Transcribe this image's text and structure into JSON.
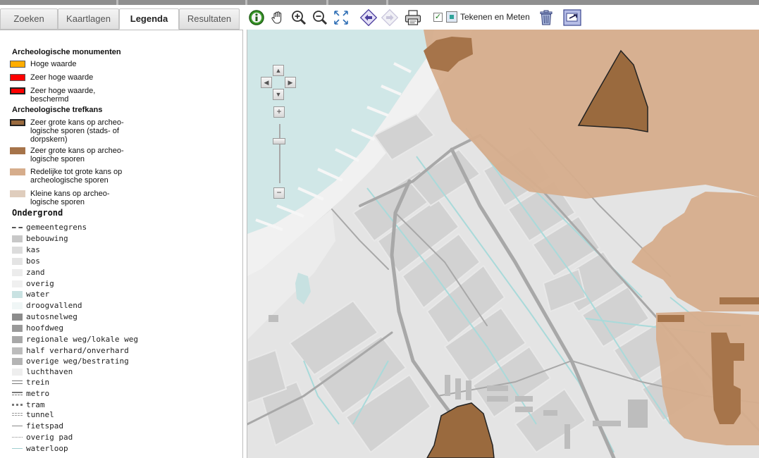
{
  "tabs": [
    {
      "label": "Zoeken"
    },
    {
      "label": "Kaartlagen"
    },
    {
      "label": "Legenda"
    },
    {
      "label": "Resultaten"
    }
  ],
  "legend": {
    "monumenten_title": "Archeologische monumenten",
    "monumenten": [
      {
        "label": "Hoge waarde",
        "color": "#ffad00"
      },
      {
        "label": "Zeer hoge waarde",
        "color": "#ff0000"
      },
      {
        "label": "Zeer hoge waarde, beschermd",
        "color": "#ff0000"
      }
    ],
    "trefkans_title": "Archeologische trefkans",
    "trefkans": [
      {
        "label": "Zeer grote kans op archeo-logische sporen (stads- of dorpskern)",
        "color": "#9a6a3e"
      },
      {
        "label": "Zeer grote kans op archeo-logische sporen",
        "color": "#a6744a"
      },
      {
        "label": "Redelijke tot grote kans op archeologische sporen",
        "color": "#d6ad8c"
      },
      {
        "label": "Kleine kans op archeo-logische sporen",
        "color": "#dfcdbd"
      }
    ],
    "ondergrond_title": "Ondergrond",
    "ondergrond": [
      {
        "label": "gemeentegrens",
        "icon": "dashed-line-icon"
      },
      {
        "label": "bebouwing",
        "color": "#c8c8c8"
      },
      {
        "label": "kas",
        "color": "#dcdcdc"
      },
      {
        "label": "bos",
        "color": "#e4e4e4"
      },
      {
        "label": "zand",
        "color": "#ececec"
      },
      {
        "label": "overig",
        "color": "#f0f0f0"
      },
      {
        "label": "water",
        "color": "#c9e2e2"
      },
      {
        "label": "droogvallend",
        "color": "#f0f6f6"
      },
      {
        "label": "autosnelweg",
        "color": "#8c8c8c"
      },
      {
        "label": "hoofdweg",
        "color": "#9a9a9a"
      },
      {
        "label": "regionale weg/lokale weg",
        "color": "#a8a8a8"
      },
      {
        "label": "half verhard/onverhard",
        "color": "#bcbcbc"
      },
      {
        "label": "overige weg/bestrating",
        "color": "#b4b4b4"
      },
      {
        "label": "luchthaven",
        "color": "#eeeeee"
      },
      {
        "label": "trein",
        "icon": "double-line-icon"
      },
      {
        "label": "metro",
        "icon": "metro-line-icon"
      },
      {
        "label": "tram",
        "icon": "tram-line-icon"
      },
      {
        "label": "tunnel",
        "icon": "tunnel-line-icon"
      },
      {
        "label": "fietspad",
        "icon": "thin-line-icon"
      },
      {
        "label": "overig pad",
        "icon": "dotted-line-icon"
      },
      {
        "label": "waterloop",
        "icon": "water-line-icon"
      }
    ]
  },
  "toolbar": {
    "tekenen_label": "Tekenen en Meten",
    "check_mark": "✓",
    "icons": [
      "info-icon",
      "pan-hand-icon",
      "zoom-in-icon",
      "zoom-out-icon",
      "full-extent-icon",
      "back-icon",
      "forward-icon",
      "print-icon",
      "delete-icon",
      "export-icon"
    ]
  },
  "map": {
    "zoom_in": "+",
    "zoom_out": "−",
    "pan_up": "▲",
    "pan_down": "▼",
    "pan_left": "◀",
    "pan_right": "▶",
    "colors": {
      "land": "#e6e6e6",
      "sea": "#cfe6e6",
      "beach": "#f0f0f0",
      "trefkans_redelijk": "#d6ad8c",
      "trefkans_zeer_groot": "#a6744a",
      "kern": "#9a6a3e"
    }
  }
}
